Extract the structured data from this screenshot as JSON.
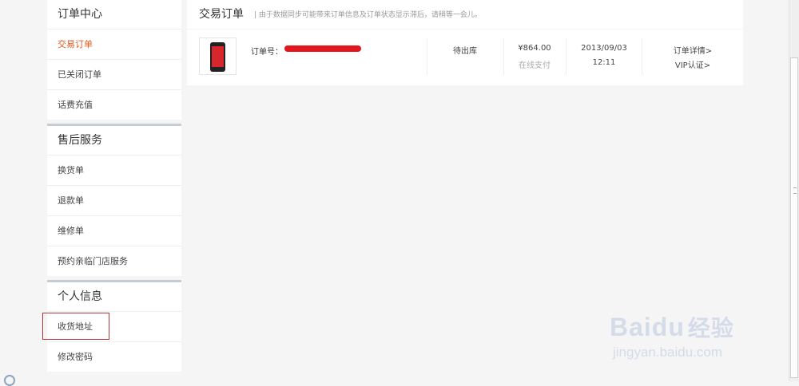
{
  "sidebar": {
    "groups": [
      {
        "title": "订单中心",
        "items": [
          "交易订单",
          "已关闭订单",
          "话费充值"
        ]
      },
      {
        "title": "售后服务",
        "items": [
          "换货单",
          "退款单",
          "维修单",
          "预约亲临门店服务"
        ]
      },
      {
        "title": "个人信息",
        "items": [
          "收货地址",
          "修改密码"
        ]
      }
    ],
    "active_item": "交易订单",
    "highlighted_item": "收货地址"
  },
  "header": {
    "title": "交易订单",
    "note": "| 由于数据同步可能带来订单信息及订单状态显示滞后，请稍等一会儿。"
  },
  "order": {
    "order_no_label": "订单号：",
    "status": "待出库",
    "price": "¥864.00",
    "payment": "在线支付",
    "date": "2013/09/03",
    "time": "12:11",
    "detail_link": "订单详情>",
    "vip_link": "VIP认证>"
  },
  "watermark": {
    "brand_left": "Bai",
    "brand_mid": "du",
    "brand_cn": "经验",
    "url": "jingyan.baidu.com"
  },
  "colors": {
    "accent": "#e35a1a",
    "highlight_border": "#b8323a",
    "redaction": "#e3151d"
  }
}
